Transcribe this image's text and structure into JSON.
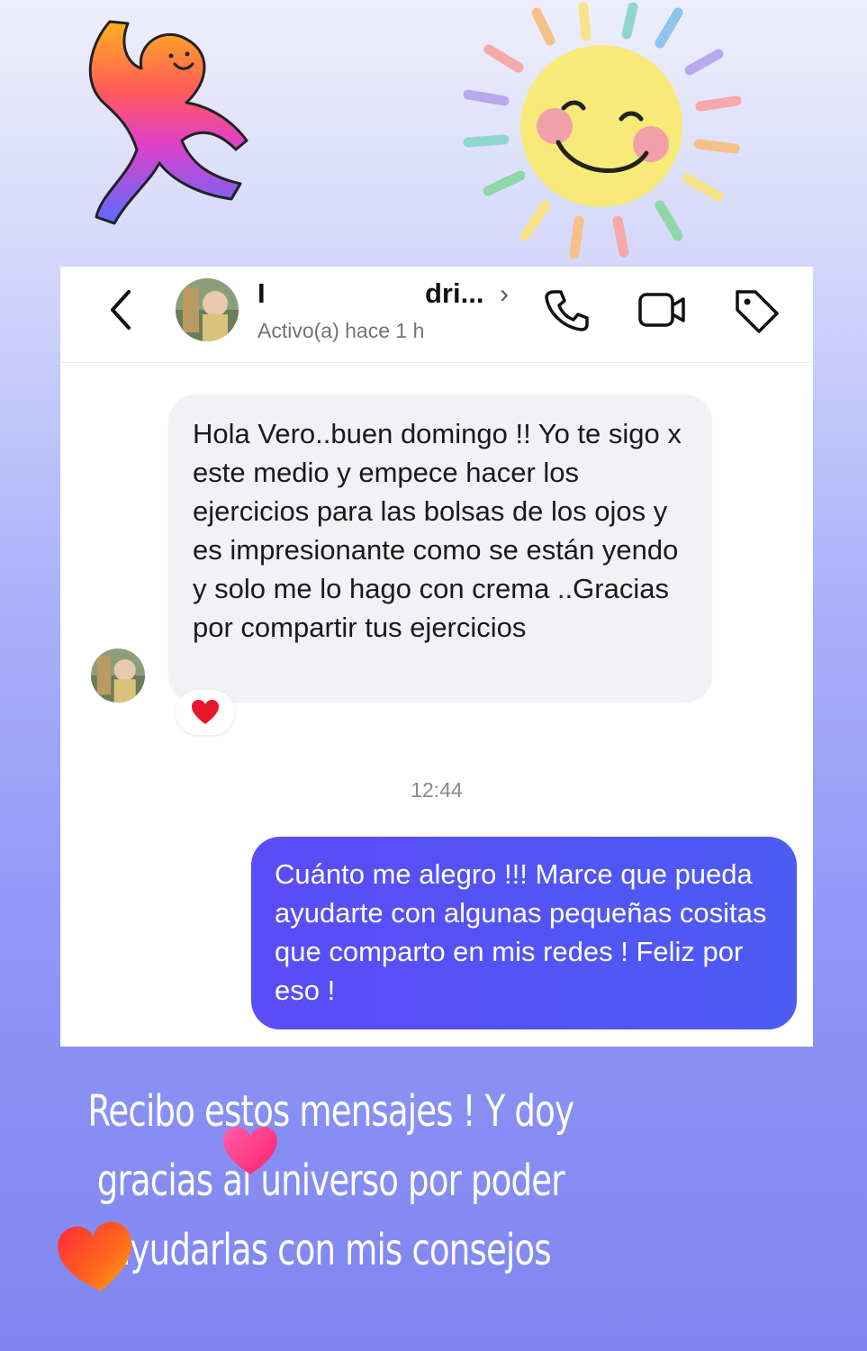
{
  "header": {
    "contact_name_start": "I",
    "contact_name_end": "dri...",
    "chevron": "›",
    "status": "Activo(a) hace 1 h",
    "icons": [
      "back-arrow-icon",
      "phone-icon",
      "video-camera-icon",
      "tag-icon"
    ]
  },
  "messages": [
    {
      "direction": "incoming",
      "text": "Hola Vero..buen domingo !! Yo te sigo x este medio y empece hacer los ejercicios para las bolsas de los ojos y es impresionante como se están yendo y solo me lo hago con crema ..Gracias por compartir tus ejercicios",
      "reaction": "❤️"
    },
    {
      "direction": "outgoing",
      "text": "Cuánto me alegro !!! Marce que pueda ayudarte con algunas pequeñas cositas que comparto en mis redes ! Feliz por eso !"
    }
  ],
  "timestamp": "12:44",
  "caption": {
    "line1": "Recibo estos mensajes ! Y doy",
    "line2": "gracias  al universo por poder",
    "line3": "ayudarlas con mis consejos"
  },
  "colors": {
    "outgoing_bubble": "#4f55f5",
    "incoming_bubble": "#f1f1f6",
    "background_top": "#eeeefb",
    "background_bottom": "#7f86ef"
  }
}
